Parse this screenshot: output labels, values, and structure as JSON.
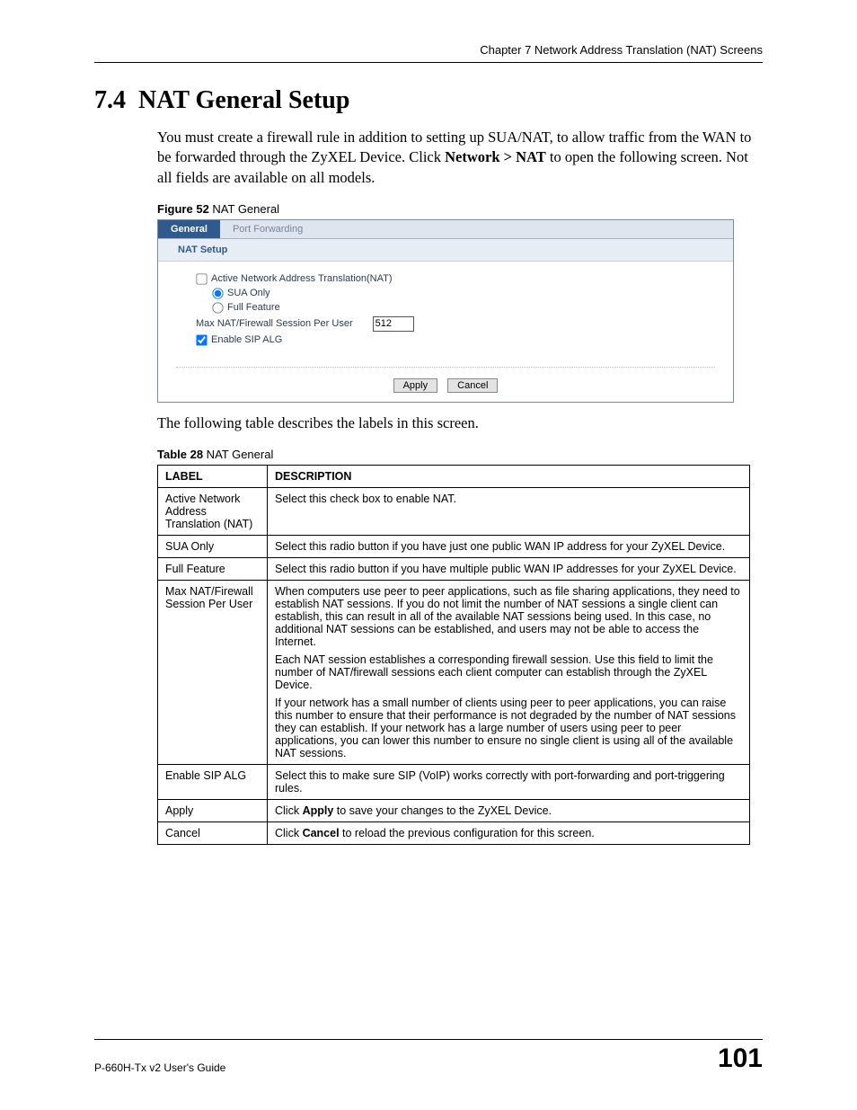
{
  "header": {
    "chapter": "Chapter 7 Network Address Translation (NAT) Screens"
  },
  "section": {
    "number": "7.4",
    "title": "NAT General Setup",
    "para1_a": "You must create a firewall rule in addition to setting up SUA/NAT, to allow traffic from the WAN to be forwarded through the ZyXEL Device. Click ",
    "para1_bold": "Network > NAT",
    "para1_b": " to open the following screen. Not all fields are available on all models.",
    "para2": "The following table describes the labels in this screen."
  },
  "figure": {
    "caption_bold": "Figure 52",
    "caption_rest": "   NAT General",
    "tabs": {
      "general": "General",
      "port_fwd": "Port Forwarding"
    },
    "group_title": "NAT Setup",
    "opts": {
      "active": "Active Network Address Translation(NAT)",
      "sua": "SUA Only",
      "full": "Full Feature",
      "max_label": "Max NAT/Firewall Session Per User",
      "max_value": "512",
      "sip": "Enable SIP ALG"
    },
    "buttons": {
      "apply": "Apply",
      "cancel": "Cancel"
    }
  },
  "table": {
    "caption_bold": "Table 28",
    "caption_rest": "   NAT General",
    "headers": {
      "label": "LABEL",
      "desc": "DESCRIPTION"
    },
    "rows": [
      {
        "label": "Active Network Address Translation (NAT)",
        "desc": [
          "Select this check box to enable NAT."
        ]
      },
      {
        "label": "SUA Only",
        "desc": [
          "Select this radio button if you have just one public WAN IP address for your ZyXEL Device."
        ]
      },
      {
        "label": "Full Feature",
        "desc": [
          "Select this radio button if you have multiple public WAN IP addresses for your ZyXEL Device."
        ]
      },
      {
        "label": "Max NAT/Firewall Session Per User",
        "desc": [
          "When computers use peer to peer applications, such as file sharing applications, they need to establish NAT sessions. If you do not limit the number of NAT sessions a single client can establish, this can result in all of the available NAT sessions being used. In this case, no additional NAT sessions can be established, and users may not be able to access the Internet.",
          "Each NAT session establishes a corresponding firewall session. Use this field to limit the number of NAT/firewall sessions each client computer can establish through the ZyXEL Device.",
          "If your network has a small number of clients using peer to peer applications, you can raise this number to ensure that their performance is not degraded by the number of NAT sessions they can establish. If your network has a large number of users using peer to peer applications, you can lower this number to ensure no single client is using all of the available NAT sessions."
        ]
      },
      {
        "label": "Enable SIP ALG",
        "desc": [
          "Select this to make sure SIP (VoIP) works correctly with port-forwarding and port-triggering rules."
        ]
      },
      {
        "label": "Apply",
        "desc_html": {
          "pre": "Click ",
          "bold": "Apply",
          "post": " to save your changes to the ZyXEL Device."
        }
      },
      {
        "label": "Cancel",
        "desc_html": {
          "pre": "Click ",
          "bold": "Cancel",
          "post": " to reload the previous configuration for this screen."
        }
      }
    ]
  },
  "footer": {
    "doc": "P-660H-Tx v2 User's Guide",
    "page": "101"
  }
}
